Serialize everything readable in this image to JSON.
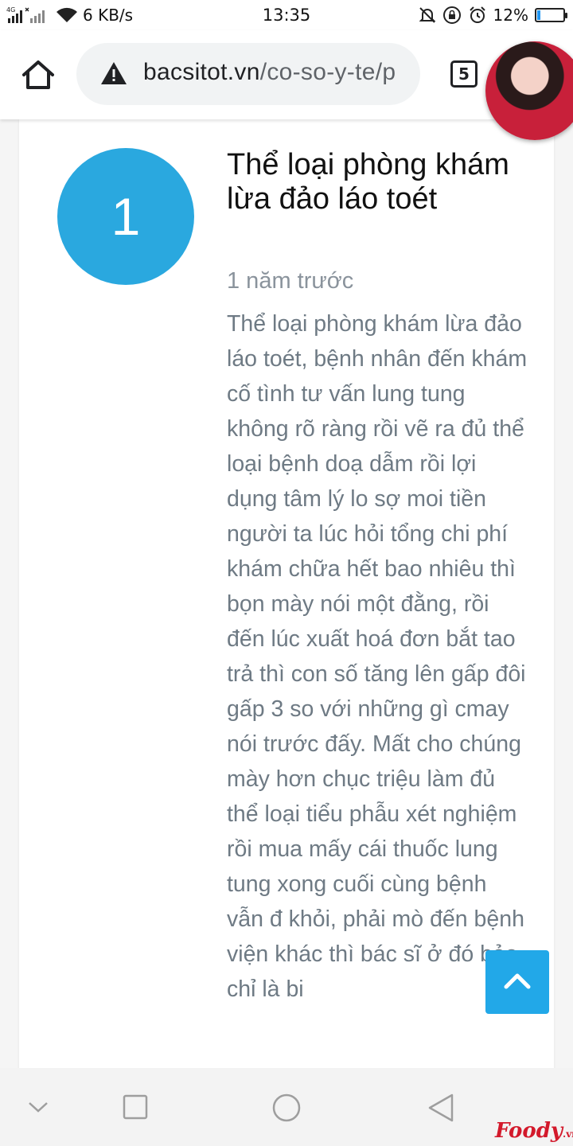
{
  "status_bar": {
    "network": "4G",
    "speed": "6 KB/s",
    "time": "13:35",
    "battery_percent": "12%",
    "battery_level": 0.12,
    "icons": [
      "signal-icon",
      "wifi-icon",
      "mute-icon",
      "rotation-lock-icon",
      "alarm-icon",
      "battery-icon"
    ]
  },
  "browser": {
    "url_domain": "bacsitot.vn",
    "url_path": "/co-so-y-te/p",
    "tab_count": "5",
    "icons": [
      "home-icon",
      "warning-icon"
    ]
  },
  "post": {
    "number": "1",
    "title": "Thể loại phòng khám lừa đảo láo toét",
    "time_ago": "1 năm trước",
    "body": "Thể loại phòng khám lừa đảo láo toét, bệnh nhân đến khám cố tình tư vấn lung tung không rõ ràng rồi vẽ ra đủ thể loại bệnh doạ dẫm rồi lợi dụng tâm lý lo sợ moi tiền người ta lúc hỏi tổng chi phí khám chữa hết bao nhiêu thì bọn mày nói một đằng, rồi đến lúc xuất hoá đơn bắt tao trả thì con số tăng lên gấp đôi gấp 3 so với những gì cmay nói trước đấy. Mất cho chúng mày hơn chục triệu làm đủ thể loại tiểu phẫu xét nghiệm rồi mua mấy cái thuốc lung tung xong cuối cùng bệnh vẫn đ khỏi, phải mò đến bệnh viện khác thì bác sĩ ở đó bảo chỉ là bi"
  },
  "watermark": {
    "brand": "Foody",
    "suffix": ".vn"
  },
  "colors": {
    "accent": "#2aa8df",
    "scroll_button": "#22a8e8",
    "body_text": "#6e7a84",
    "time_text": "#8a939c",
    "watermark": "#d3192b"
  }
}
